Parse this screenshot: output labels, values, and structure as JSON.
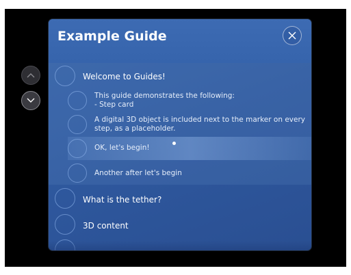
{
  "guide": {
    "title": "Example Guide"
  },
  "steps": [
    {
      "label": "Welcome to Guides!",
      "substeps": [
        {
          "line1": "This guide demonstrates the following:",
          "line2": "- Step card"
        },
        {
          "line1": "A digital 3D object is included next to the marker on every",
          "line2": "step, as a placeholder."
        },
        {
          "line1": "OK, let's begin!",
          "line2": ""
        },
        {
          "line1": "Another after let's begin",
          "line2": ""
        }
      ]
    },
    {
      "label": "What is the tether?"
    },
    {
      "label": "3D content"
    }
  ],
  "colors": {
    "panel": "#3763a8",
    "background": "#000000",
    "text": "#ffffff"
  },
  "icons": {
    "up": "chevron-up-icon",
    "down": "chevron-down-icon",
    "close": "close-icon"
  }
}
